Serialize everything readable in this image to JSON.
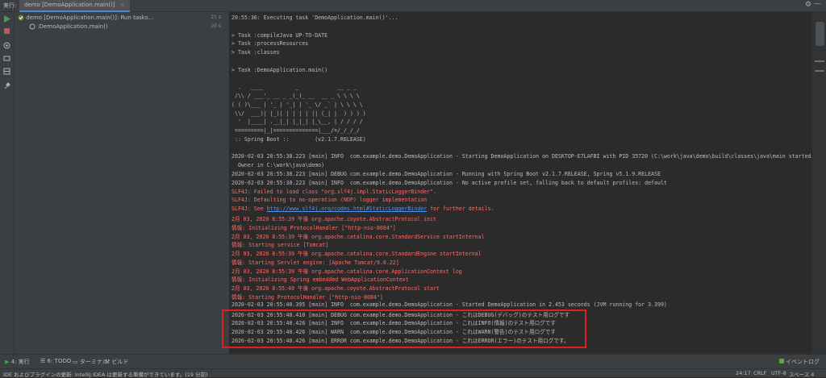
{
  "tabbar": {
    "run_label": "実行:",
    "tab_label": "demo [DemoApplication.main()]",
    "close": "×",
    "gear_icon": "⚙",
    "minimize_icon": "—"
  },
  "tree": {
    "root_label": "demo [DemoApplication.main()]: Run tasks...",
    "root_time": "21 s",
    "child_label": ":DemoApplication.main()",
    "child_time": "20 s"
  },
  "console": {
    "lines": [
      {
        "text": "20:55:36: Executing task 'DemoApplication.main()'...",
        "style": "normal"
      },
      {
        "text": "",
        "style": "normal"
      },
      {
        "text": "> Task :compileJava UP-TO-DATE",
        "style": "normal"
      },
      {
        "text": "> Task :processResources",
        "style": "normal"
      },
      {
        "text": "> Task :classes",
        "style": "normal"
      },
      {
        "text": "",
        "style": "normal"
      },
      {
        "text": "> Task :DemoApplication.main()",
        "style": "normal"
      },
      {
        "text": "",
        "style": "normal"
      },
      {
        "text": "  .   ____          _            __ _ _",
        "style": "normal"
      },
      {
        "text": " /\\\\ / ___'_ __ _ _(_)_ __  __ _ \\ \\ \\ \\",
        "style": "normal"
      },
      {
        "text": "( ( )\\___ | '_ | '_| | '_ \\/ _` | \\ \\ \\ \\",
        "style": "normal"
      },
      {
        "text": " \\\\/  ___)| |_)| | | | | || (_| |  ) ) ) )",
        "style": "normal"
      },
      {
        "text": "  '  |____| .__|_| |_|_| |_\\__, | / / / /",
        "style": "normal"
      },
      {
        "text": " =========|_|==============|___/=/_/_/_/",
        "style": "normal"
      },
      {
        "text": " :: Spring Boot ::        (v2.1.7.RELEASE)",
        "style": "normal"
      },
      {
        "text": "",
        "style": "normal"
      },
      {
        "text": "2020-02-03 20:55:38.223 [main] INFO  com.example.demo.DemoApplication - Starting DemoApplication on DESKTOP-E7LAFBI with PID 35720 (C:\\work\\java\\demo\\build\\classes\\java\\main started by",
        "style": "normal"
      },
      {
        "text": "  Owner in C:\\work\\java\\demo)",
        "style": "normal"
      },
      {
        "text": "2020-02-03 20:55:38.223 [main] DEBUG com.example.demo.DemoApplication - Running with Spring Boot v2.1.7.RELEASE, Spring v5.1.9.RELEASE",
        "style": "normal"
      },
      {
        "text": "2020-02-03 20:55:38.223 [main] INFO  com.example.demo.DemoApplication - No active profile set, falling back to default profiles: default",
        "style": "normal"
      },
      {
        "text": "SLF4J: Failed to load class \"org.slf4j.impl.StaticLoggerBinder\".",
        "style": "red"
      },
      {
        "text": "SLF4J: Defaulting to no-operation (NOP) logger implementation",
        "style": "red"
      },
      {
        "text": "SLF4J: See ",
        "style": "red",
        "link": "http://www.slf4j.org/codes.html#StaticLoggerBinder",
        "after": " for further details."
      },
      {
        "text": "2月 03, 2020 8:55:39 午後 org.apache.coyote.AbstractProtocol init",
        "style": "red"
      },
      {
        "text": "情報: Initializing ProtocolHandler [\"http-nio-8084\"]",
        "style": "red"
      },
      {
        "text": "2月 03, 2020 8:55:39 午後 org.apache.catalina.core.StandardService startInternal",
        "style": "red"
      },
      {
        "text": "情報: Starting service [Tomcat]",
        "style": "red"
      },
      {
        "text": "2月 03, 2020 8:55:39 午後 org.apache.catalina.core.StandardEngine startInternal",
        "style": "red"
      },
      {
        "text": "情報: Starting Servlet engine: [Apache Tomcat/9.0.22]",
        "style": "red"
      },
      {
        "text": "2月 03, 2020 8:55:39 午後 org.apache.catalina.core.ApplicationContext log",
        "style": "red"
      },
      {
        "text": "情報: Initializing Spring embedded WebApplicationContext",
        "style": "red"
      },
      {
        "text": "2月 03, 2020 8:55:40 午後 org.apache.coyote.AbstractProtocol start",
        "style": "red"
      },
      {
        "text": "情報: Starting ProtocolHandler [\"http-nio-8084\"]",
        "style": "red"
      },
      {
        "text": "2020-02-03 20:55:40.395 [main] INFO  com.example.demo.DemoApplication - Started DemoApplication in 2.453 seconds (JVM running for 3.399)",
        "style": "normal"
      },
      {
        "text": "2020-02-03 20:55:40.410 [main] DEBUG com.example.demo.DemoApplication - これはDEBUG(デバッグ)のテスト用ログです",
        "style": "normal"
      },
      {
        "text": "2020-02-03 20:55:40.426 [main] INFO  com.example.demo.DemoApplication - これはINFO(情報)のテスト用ログです",
        "style": "normal"
      },
      {
        "text": "2020-02-03 20:55:40.426 [main] WARN  com.example.demo.DemoApplication - これはWARN(警告)のテスト用ログです",
        "style": "normal"
      },
      {
        "text": "2020-02-03 20:55:40.426 [main] ERROR com.example.demo.DemoApplication - これはERROR(エラー)のテスト用ログです。",
        "style": "normal"
      }
    ]
  },
  "bottombar": {
    "run_tab": "4: 実行",
    "todo_tab": "6: TODO",
    "terminal_tab": "ターミナル",
    "build_tab": "ビルド",
    "event_log": "イベントログ"
  },
  "statusbar": {
    "message": "IDE およびプラグインの更新: IntelliJ IDEA は更新する準備ができています。(19 分前)",
    "position": "24:17",
    "line_sep": "CRLF",
    "encoding": "UTF-8",
    "indent": "スペース 4"
  },
  "colors": {
    "accent": "#4a88c7",
    "error_text": "#ff6b68",
    "highlight_box": "#e02020",
    "link": "#5394ec"
  }
}
